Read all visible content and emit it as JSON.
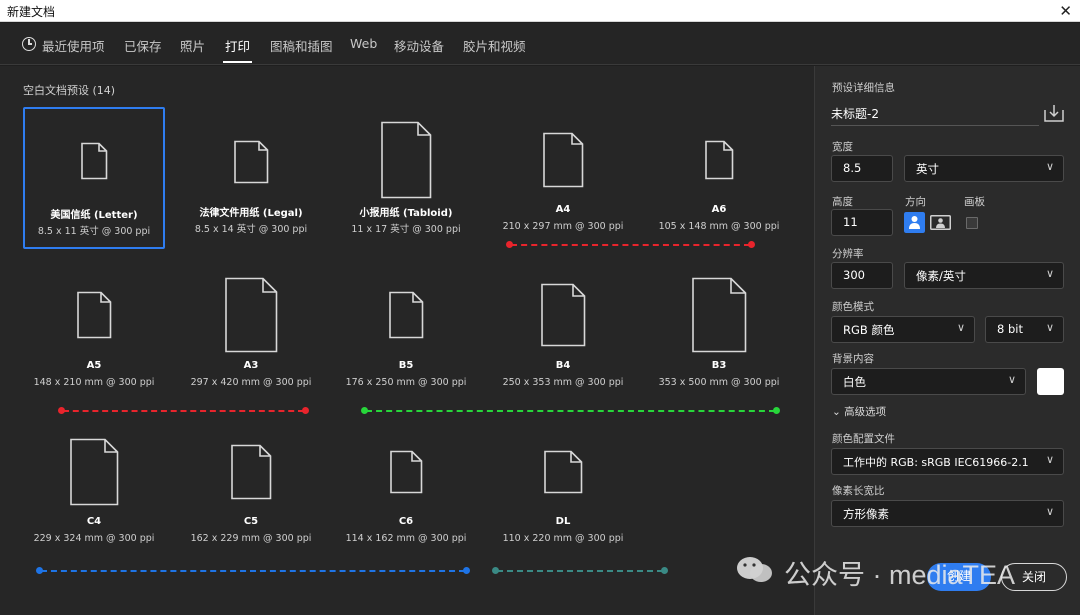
{
  "window": {
    "title": "新建文档",
    "close_glyph": "✕"
  },
  "tabs": [
    {
      "label": "最近使用项"
    },
    {
      "label": "已保存"
    },
    {
      "label": "照片"
    },
    {
      "label": "打印",
      "active": true
    },
    {
      "label": "图稿和插图"
    },
    {
      "label": "Web"
    },
    {
      "label": "移动设备"
    },
    {
      "label": "胶片和视频"
    }
  ],
  "presets_heading": "空白文档预设 (14)",
  "presets": [
    {
      "name": "美国信纸 (Letter)",
      "size": "8.5 x 11 英寸 @ 300 ppi",
      "selected": true
    },
    {
      "name": "法律文件用纸 (Legal)",
      "size": "8.5 x 14 英寸 @ 300 ppi"
    },
    {
      "name": "小报用纸 (Tabloid)",
      "size": "11 x 17 英寸 @ 300 ppi"
    },
    {
      "name": "A4",
      "size": "210 x 297 mm @ 300 ppi"
    },
    {
      "name": "A6",
      "size": "105 x 148 mm @ 300 ppi"
    },
    {
      "name": "A5",
      "size": "148 x 210 mm @ 300 ppi"
    },
    {
      "name": "A3",
      "size": "297 x 420 mm @ 300 ppi"
    },
    {
      "name": "B5",
      "size": "176 x 250 mm @ 300 ppi"
    },
    {
      "name": "B4",
      "size": "250 x 353 mm @ 300 ppi"
    },
    {
      "name": "B3",
      "size": "353 x 500 mm @ 300 ppi"
    },
    {
      "name": "C4",
      "size": "229 x 324 mm @ 300 ppi"
    },
    {
      "name": "C5",
      "size": "162 x 229 mm @ 300 ppi"
    },
    {
      "name": "C6",
      "size": "114 x 162 mm @ 300 ppi"
    },
    {
      "name": "DL",
      "size": "110 x 220 mm @ 300 ppi"
    }
  ],
  "annotation_colors": {
    "red": "#e8242c",
    "green": "#27d63a",
    "blue": "#1e74e6",
    "teal": "#3a8a85"
  },
  "panel": {
    "heading": "预设详细信息",
    "doc_title": "未标题-2",
    "width_label": "宽度",
    "width_value": "8.5",
    "unit_value": "英寸",
    "height_label": "高度",
    "height_value": "11",
    "orientation_label": "方向",
    "artboard_label": "画板",
    "resolution_label": "分辨率",
    "resolution_value": "300",
    "resolution_unit": "像素/英寸",
    "color_mode_label": "颜色模式",
    "color_mode_value": "RGB 颜色",
    "bit_depth_value": "8 bit",
    "bg_label": "背景内容",
    "bg_value": "白色",
    "bg_swatch_color": "#ffffff",
    "advanced_label": "高级选项",
    "profile_label": "颜色配置文件",
    "profile_value": "工作中的 RGB: sRGB IEC61966-2.1",
    "pixel_aspect_label": "像素长宽比",
    "pixel_aspect_value": "方形像素",
    "create_label": "创建",
    "close_label": "关闭",
    "accent_color": "#2f7df0"
  },
  "watermark": {
    "text": "公众号 · mediaTEA"
  }
}
